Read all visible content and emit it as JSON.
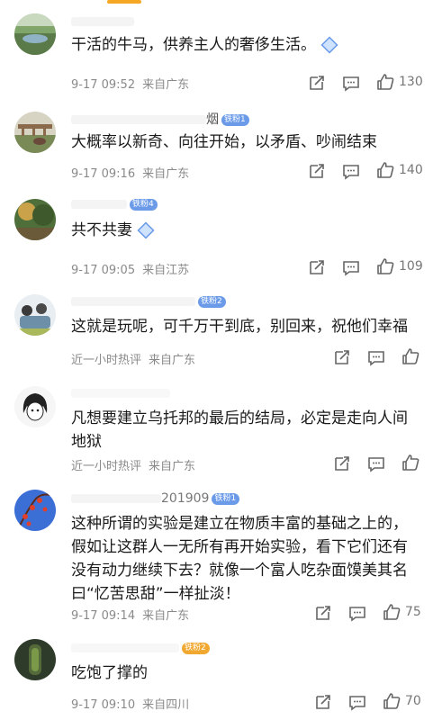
{
  "comments": [
    {
      "name": "",
      "badge": "",
      "text": "干活的牛马，供养主人的奢侈生活。",
      "time": "9-17 09:52",
      "location": "来自广东",
      "likes": "130"
    },
    {
      "name": "烟",
      "badge": "铁粉1",
      "text": "大概率以新奇、向往开始，以矛盾、吵闹结束",
      "time": "9-17 09:16",
      "location": "来自广东",
      "likes": "140"
    },
    {
      "name": "",
      "badge": "铁粉4",
      "text": "共不共妻",
      "time": "9-17 09:05",
      "location": "来自江苏",
      "likes": "109"
    },
    {
      "name": "",
      "badge": "铁粉2",
      "text": "这就是玩呢，可千万干到底，别回来，祝他们幸福",
      "time": "近一小时热评",
      "location": "来自广东",
      "likes": ""
    },
    {
      "name": "",
      "badge": "",
      "text": "凡想要建立乌托邦的最后的结局，必定是走向人间地狱",
      "time": "近一小时热评",
      "location": "来自广东",
      "likes": ""
    },
    {
      "name": "201909",
      "badge": "铁粉1",
      "text": "这种所谓的实验是建立在物质丰富的基础之上的，假如让这群人一无所有再开始实验，看下它们还有没有动力继续下去？就像一个富人吃杂面馍美其名曰“忆苦思甜”一样扯淡！",
      "time": "9-17 09:14",
      "location": "来自广东",
      "likes": "75"
    },
    {
      "name": "",
      "badge": "铁粉2",
      "text": "吃饱了撑的",
      "time": "9-17 09:10",
      "location": "来自四川",
      "likes": "70"
    }
  ],
  "icons": [
    "share-icon",
    "comment-icon",
    "like-icon"
  ]
}
